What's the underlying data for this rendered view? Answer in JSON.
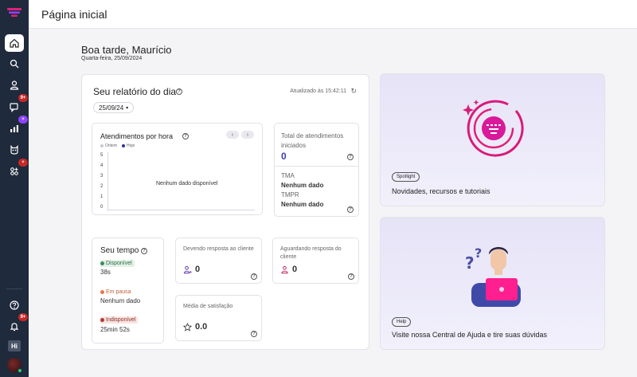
{
  "sidebar": {
    "items": [
      {
        "name": "home-icon",
        "badge": ""
      },
      {
        "name": "search-icon",
        "badge": ""
      },
      {
        "name": "user-icon",
        "badge": ""
      },
      {
        "name": "chat-icon",
        "badge": "9+"
      },
      {
        "name": "chart-icon",
        "badge": "+"
      },
      {
        "name": "bot-icon",
        "badge": ""
      },
      {
        "name": "apps-icon",
        "badge": "+"
      }
    ],
    "bottom": {
      "notifications_badge": "9+",
      "hi_label": "Hi"
    }
  },
  "header": {
    "title": "Página inicial"
  },
  "greeting": {
    "title": "Boa tarde, Maurício",
    "date": "Quarta-feira, 25/09/2024"
  },
  "report": {
    "title": "Seu relatório do dia",
    "updated": "Atualizado às 15:42:11",
    "date_filter": "25/09/24"
  },
  "attendance_chart": {
    "title": "Atendimentos por hora",
    "legend": [
      {
        "label": "Ontem",
        "color": "#c8c8d4"
      },
      {
        "label": "Hoje",
        "color": "#2f2f9e"
      }
    ],
    "empty_message": "Nenhum dado disponível"
  },
  "chart_data": {
    "type": "line",
    "title": "Atendimentos por hora",
    "series": [
      {
        "name": "Ontem",
        "values": []
      },
      {
        "name": "Hoje",
        "values": []
      }
    ],
    "y_ticks": [
      "5",
      "4",
      "3",
      "2",
      "1",
      "0"
    ],
    "ylim": [
      0,
      5
    ]
  },
  "totals": {
    "label": "Total de atendimentos iniciados",
    "value": "0",
    "tma_label": "TMA",
    "tma_value": "Nenhum dado",
    "tmpr_label": "TMPR",
    "tmpr_value": "Nenhum dado"
  },
  "time": {
    "title": "Seu tempo",
    "statuses": [
      {
        "label": "Disponível",
        "value": "38s",
        "color": "#3b8f5a",
        "bg": "#e3f1e7"
      },
      {
        "label": "Em pausa",
        "value": "Nenhum dado",
        "color": "#e07b4a",
        "bg": "#ffffff"
      },
      {
        "label": "Indisponível",
        "value": "25min 52s",
        "color": "#b23a2e",
        "bg": "#f7e5e2"
      }
    ]
  },
  "metrics": {
    "awaiting_reply": {
      "label": "Devendo resposta ao cliente",
      "value": "0"
    },
    "awaiting_client": {
      "label": "Aguardando resposta do cliente",
      "value": "0"
    },
    "satisfaction": {
      "label": "Média de satisfação",
      "value": "0.0"
    }
  },
  "spotlight": {
    "tag": "Spotlight",
    "text": "Novidades, recursos e tutoriais"
  },
  "help": {
    "tag": "Help",
    "text": "Visite nossa Central de Ajuda e tire suas dúvidas"
  },
  "colors": {
    "sidebar_bg": "#1f2a3c",
    "accent": "#3b3bb5",
    "brand_pink": "#e0207a"
  }
}
